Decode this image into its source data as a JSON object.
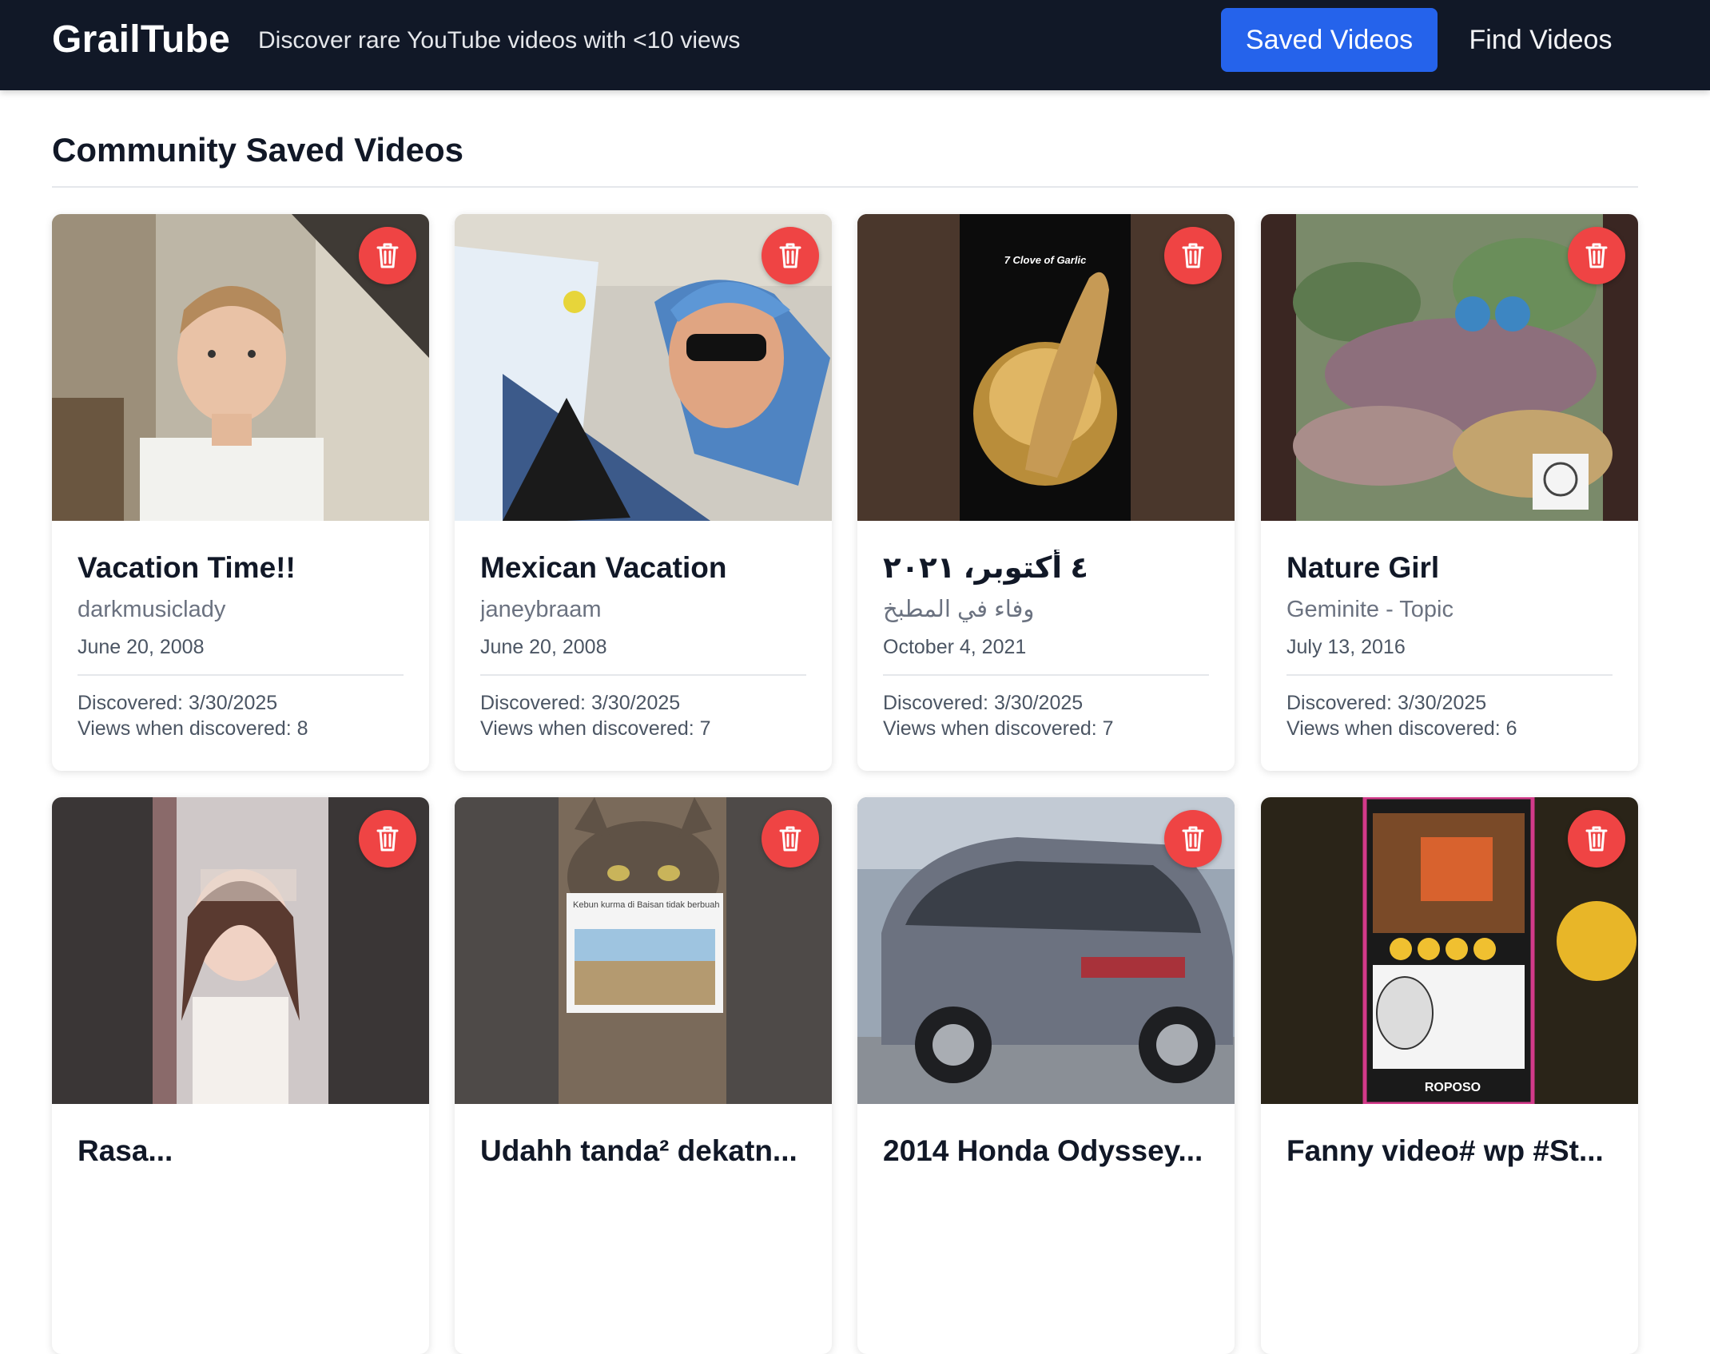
{
  "header": {
    "brand": "GrailTube",
    "tagline": "Discover rare YouTube videos with <10 views",
    "nav": {
      "saved_label": "Saved Videos",
      "find_label": "Find Videos"
    }
  },
  "colors": {
    "header_bg": "#111827",
    "accent": "#2563eb",
    "delete": "#ef4444"
  },
  "main": {
    "section_title": "Community Saved Videos",
    "videos": [
      {
        "title": "Vacation Time!!",
        "channel": "darkmusiclady",
        "date": "June 20, 2008",
        "discovered": "Discovered: 3/30/2025",
        "views": "Views when discovered: 8",
        "thumb_icon": "boy-photo-icon"
      },
      {
        "title": "Mexican Vacation",
        "channel": "janeybraam",
        "date": "June 20, 2008",
        "discovered": "Discovered: 3/30/2025",
        "views": "Views when discovered: 7",
        "thumb_icon": "man-sunglasses-photo-icon"
      },
      {
        "title": "٤ أكتوبر، ٢٠٢١",
        "channel": "وفاء في المطبخ",
        "date": "October 4, 2021",
        "discovered": "Discovered: 3/30/2025",
        "views": "Views when discovered: 7",
        "thumb_icon": "mortar-pestle-photo-icon",
        "thumb_text": "7 Clove of Garlic"
      },
      {
        "title": "Nature Girl",
        "channel": "Geminite - Topic",
        "date": "July 13, 2016",
        "discovered": "Discovered: 3/30/2025",
        "views": "Views when discovered: 6",
        "thumb_icon": "garden-photo-icon"
      },
      {
        "title": "Rasa...",
        "thumb_icon": "girl-photo-icon"
      },
      {
        "title": "Udahh tanda² dekatn...",
        "thumb_icon": "cat-photo-icon",
        "thumb_text": "Kebun kurma di Baisan tidak berbuah"
      },
      {
        "title": "2014 Honda Odyssey...",
        "thumb_icon": "minivan-photo-icon"
      },
      {
        "title": "Fanny video# wp #St...",
        "thumb_icon": "meme-photo-icon",
        "thumb_text": "ROPOSO"
      }
    ]
  }
}
